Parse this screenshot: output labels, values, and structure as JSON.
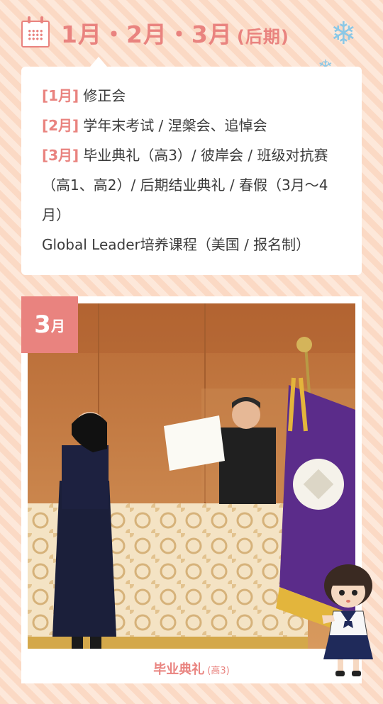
{
  "header": {
    "title": "1月・2月・3月",
    "title_suffix": "(后期)"
  },
  "icons": {
    "calendar": "calendar-icon",
    "snowflake": "snowflake-icon"
  },
  "events": [
    {
      "month": "[1月]",
      "text": "修正会"
    },
    {
      "month": "[2月]",
      "text": "学年末考试 / 涅槃会、追悼会"
    },
    {
      "month": "[3月]",
      "text": "毕业典礼（高3）/ 彼岸会 / 班级对抗赛（高1、高2）/ 后期结业典礼 / 春假（3月～4月）"
    }
  ],
  "extra_event": "Global Leader培养课程（美国 / 报名制）",
  "photo_card": {
    "badge_number": "3",
    "badge_unit": "月",
    "caption": "毕业典礼",
    "caption_note": "(高3)"
  },
  "colors": {
    "accent": "#e9837f",
    "text": "#3b3b3b",
    "snow": "#8cc8e6",
    "background": "#fde6d6"
  }
}
